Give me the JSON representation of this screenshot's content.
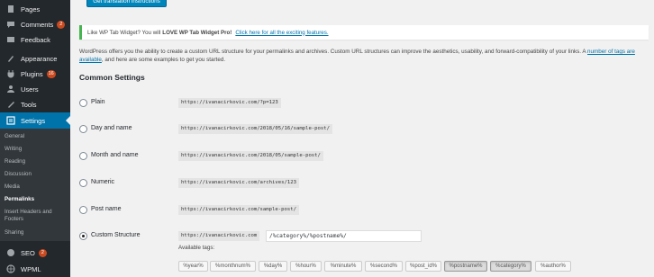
{
  "sidebar": {
    "items": [
      {
        "label": "Pages",
        "icon": "pages-icon",
        "badge": ""
      },
      {
        "label": "Comments",
        "icon": "comments-icon",
        "badge": "2"
      },
      {
        "label": "Feedback",
        "icon": "feedback-icon",
        "badge": ""
      },
      {
        "label": "Appearance",
        "icon": "appearance-icon",
        "badge": ""
      },
      {
        "label": "Plugins",
        "icon": "plugins-icon",
        "badge": "16"
      },
      {
        "label": "Users",
        "icon": "users-icon",
        "badge": ""
      },
      {
        "label": "Tools",
        "icon": "tools-icon",
        "badge": ""
      },
      {
        "label": "Settings",
        "icon": "settings-icon",
        "badge": ""
      }
    ],
    "submenu": [
      "General",
      "Writing",
      "Reading",
      "Discussion",
      "Media",
      "Permalinks",
      "Insert Headers and Footers",
      "Sharing"
    ],
    "bottom_items": [
      {
        "label": "SEO",
        "icon": "seo-icon",
        "badge": "2"
      },
      {
        "label": "WPML",
        "icon": "wpml-icon",
        "badge": ""
      }
    ],
    "accent_color": "#0073aa",
    "badge_color": "#ca4a1f"
  },
  "top_button": "Get translation instructions",
  "notice": {
    "prefix": "Like WP Tab Widget? You will",
    "bold": "LOVE WP Tab Widget Pro!",
    "link": "Click here for all the exciting features."
  },
  "intro": {
    "text": "WordPress offers you the ability to create a custom URL structure for your permalinks and archives. Custom URL structures can improve the aesthetics, usability, and forward-compatibility of your links. A ",
    "link": "number of tags are available",
    "suffix": ", and here are some examples to get you started."
  },
  "section_title": "Common Settings",
  "options": [
    {
      "label": "Plain",
      "example": "https://ivanacirkovic.com/?p=123",
      "checked": false
    },
    {
      "label": "Day and name",
      "example": "https://ivanacirkovic.com/2018/05/16/sample-post/",
      "checked": false
    },
    {
      "label": "Month and name",
      "example": "https://ivanacirkovic.com/2018/05/sample-post/",
      "checked": false
    },
    {
      "label": "Numeric",
      "example": "https://ivanacirkovic.com/archives/123",
      "checked": false
    },
    {
      "label": "Post name",
      "example": "https://ivanacirkovic.com/sample-post/",
      "checked": false
    },
    {
      "label": "Custom Structure",
      "example": "https://ivanacirkovic.com",
      "checked": true
    }
  ],
  "custom_structure_value": "/%category%/%postname%/",
  "available_tags_label": "Available tags:",
  "tags": [
    {
      "label": "%year%",
      "pressed": false
    },
    {
      "label": "%monthnum%",
      "pressed": false
    },
    {
      "label": "%day%",
      "pressed": false
    },
    {
      "label": "%hour%",
      "pressed": false
    },
    {
      "label": "%minute%",
      "pressed": false
    },
    {
      "label": "%second%",
      "pressed": false
    },
    {
      "label": "%post_id%",
      "pressed": false
    },
    {
      "label": "%postname%",
      "pressed": true
    },
    {
      "label": "%category%",
      "pressed": true
    },
    {
      "label": "%author%",
      "pressed": false
    }
  ]
}
